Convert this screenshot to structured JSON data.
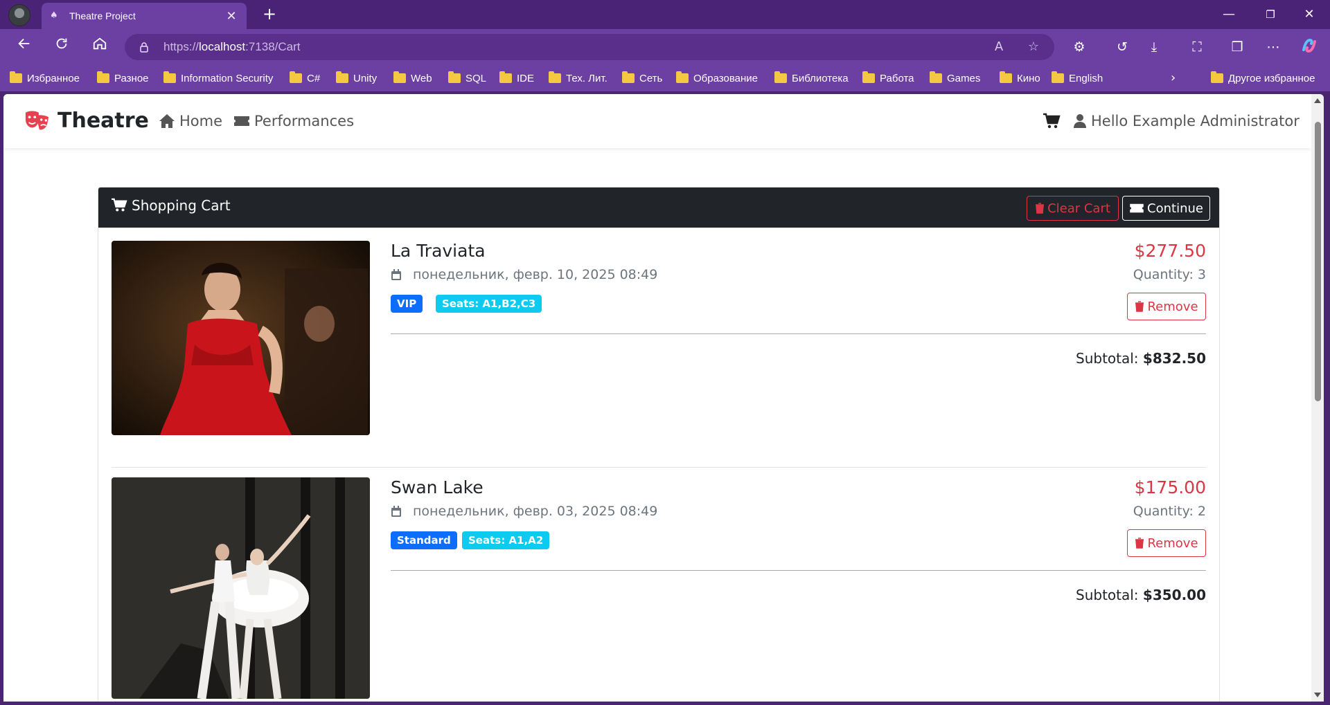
{
  "browser": {
    "tab_title": "Theatre Project",
    "tab_close": "✕",
    "new_tab": "+",
    "url_prefix": "https://",
    "url_host": "localhost",
    "url_rest": ":7138/Cart",
    "window_controls": {
      "minimize": "—",
      "restore": "❐",
      "close": "✕"
    }
  },
  "bookmarks": [
    "Избранное",
    "Разное",
    "Information Security",
    "C#",
    "Unity",
    "Web",
    "SQL",
    "IDE",
    "Тех. Лит.",
    "Сеть",
    "Образование",
    "Библиотека",
    "Работа",
    "Games",
    "Кино",
    "English"
  ],
  "bookmarks_other": "Другое избранное",
  "site": {
    "brand": "Theatre",
    "nav": {
      "home": "Home",
      "performances": "Performances"
    },
    "user_greeting": "Hello Example Administrator"
  },
  "cart": {
    "title": "Shopping Cart",
    "clear_label": "Clear Cart",
    "continue_label": "Continue",
    "items": [
      {
        "name": "La Traviata",
        "date": "понедельник, февр. 10, 2025 08:49",
        "type": "VIP",
        "seats": "Seats: A1,B2,C3",
        "price": "$277.50",
        "quantity": "Quantity: 3",
        "remove_label": "Remove",
        "subtotal_label": "Subtotal:",
        "subtotal": "$832.50"
      },
      {
        "name": "Swan Lake",
        "date": "понедельник, февр. 03, 2025 08:49",
        "type": "Standard",
        "seats": "Seats: A1,A2",
        "price": "$175.00",
        "quantity": "Quantity: 2",
        "remove_label": "Remove",
        "subtotal_label": "Subtotal:",
        "subtotal": "$350.00"
      }
    ]
  },
  "colors": {
    "browser_frame": "#4b2376",
    "browser_toolbar": "#6c3fa3",
    "danger": "#dc3545",
    "primary": "#0d6efd",
    "info": "#0dcaf0",
    "dark": "#212529"
  },
  "icons": {
    "brand": "theater-masks-icon",
    "home": "home-icon",
    "performances": "ticket-icon",
    "cart": "cart-icon",
    "user": "user-icon",
    "date": "calendar-icon",
    "remove": "trash-icon"
  }
}
